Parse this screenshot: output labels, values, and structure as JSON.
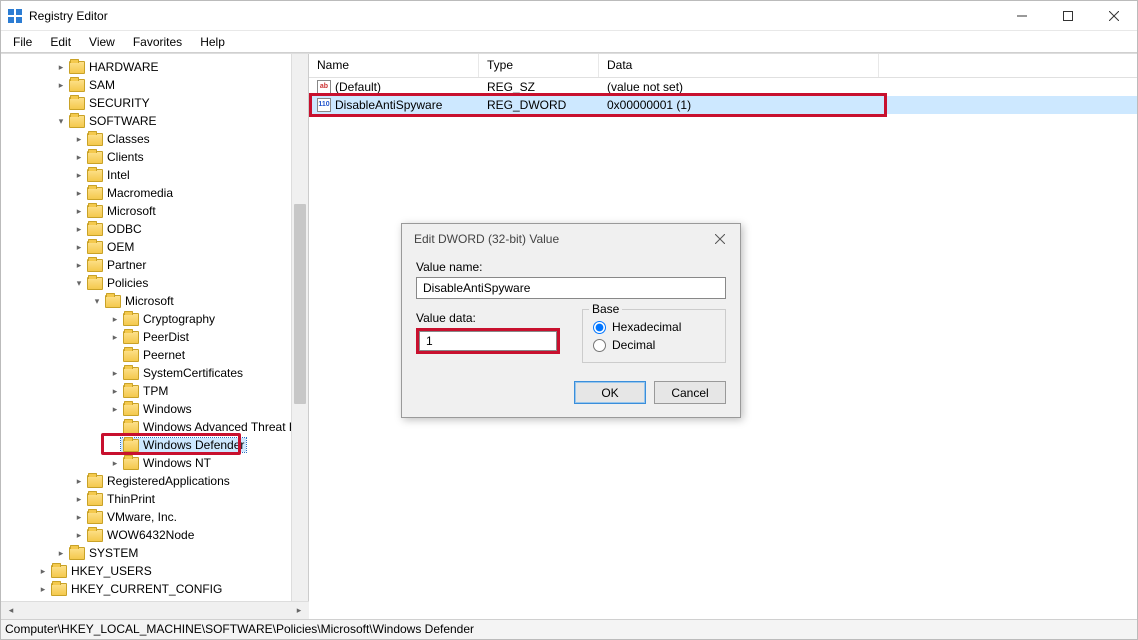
{
  "app": {
    "title": "Registry Editor"
  },
  "menu": {
    "file": "File",
    "edit": "Edit",
    "view": "View",
    "favorites": "Favorites",
    "help": "Help"
  },
  "tree": [
    {
      "depth": 2,
      "exp": "▸",
      "label": "HARDWARE"
    },
    {
      "depth": 2,
      "exp": "▸",
      "label": "SAM"
    },
    {
      "depth": 2,
      "exp": "",
      "label": "SECURITY"
    },
    {
      "depth": 2,
      "exp": "▾",
      "label": "SOFTWARE"
    },
    {
      "depth": 3,
      "exp": "▸",
      "label": "Classes"
    },
    {
      "depth": 3,
      "exp": "▸",
      "label": "Clients"
    },
    {
      "depth": 3,
      "exp": "▸",
      "label": "Intel"
    },
    {
      "depth": 3,
      "exp": "▸",
      "label": "Macromedia"
    },
    {
      "depth": 3,
      "exp": "▸",
      "label": "Microsoft"
    },
    {
      "depth": 3,
      "exp": "▸",
      "label": "ODBC"
    },
    {
      "depth": 3,
      "exp": "▸",
      "label": "OEM"
    },
    {
      "depth": 3,
      "exp": "▸",
      "label": "Partner"
    },
    {
      "depth": 3,
      "exp": "▾",
      "label": "Policies"
    },
    {
      "depth": 4,
      "exp": "▾",
      "label": "Microsoft"
    },
    {
      "depth": 5,
      "exp": "▸",
      "label": "Cryptography"
    },
    {
      "depth": 5,
      "exp": "▸",
      "label": "PeerDist"
    },
    {
      "depth": 5,
      "exp": "",
      "label": "Peernet"
    },
    {
      "depth": 5,
      "exp": "▸",
      "label": "SystemCertificates"
    },
    {
      "depth": 5,
      "exp": "▸",
      "label": "TPM"
    },
    {
      "depth": 5,
      "exp": "▸",
      "label": "Windows"
    },
    {
      "depth": 5,
      "exp": "",
      "label": "Windows Advanced Threat P"
    },
    {
      "depth": 5,
      "exp": "",
      "label": "Windows Defender",
      "selected": true,
      "highlighted": true
    },
    {
      "depth": 5,
      "exp": "▸",
      "label": "Windows NT"
    },
    {
      "depth": 3,
      "exp": "▸",
      "label": "RegisteredApplications"
    },
    {
      "depth": 3,
      "exp": "▸",
      "label": "ThinPrint"
    },
    {
      "depth": 3,
      "exp": "▸",
      "label": "VMware, Inc."
    },
    {
      "depth": 3,
      "exp": "▸",
      "label": "WOW6432Node"
    },
    {
      "depth": 2,
      "exp": "▸",
      "label": "SYSTEM"
    },
    {
      "depth": 1,
      "exp": "▸",
      "label": "HKEY_USERS"
    },
    {
      "depth": 1,
      "exp": "▸",
      "label": "HKEY_CURRENT_CONFIG"
    }
  ],
  "list": {
    "headers": {
      "name": "Name",
      "type": "Type",
      "data": "Data"
    },
    "rows": [
      {
        "icon": "sz",
        "name": "(Default)",
        "type": "REG_SZ",
        "data": "(value not set)"
      },
      {
        "icon": "dw",
        "name": "DisableAntiSpyware",
        "type": "REG_DWORD",
        "data": "0x00000001 (1)",
        "selected": true,
        "highlighted": true
      }
    ]
  },
  "statusbar": {
    "path": "Computer\\HKEY_LOCAL_MACHINE\\SOFTWARE\\Policies\\Microsoft\\Windows Defender"
  },
  "dialog": {
    "title": "Edit DWORD (32-bit) Value",
    "value_name_label": "Value name:",
    "value_name": "DisableAntiSpyware",
    "value_data_label": "Value data:",
    "value_data": "1",
    "base_label": "Base",
    "hex_label": "Hexadecimal",
    "dec_label": "Decimal",
    "base_selected": "hex",
    "ok_label": "OK",
    "cancel_label": "Cancel"
  }
}
